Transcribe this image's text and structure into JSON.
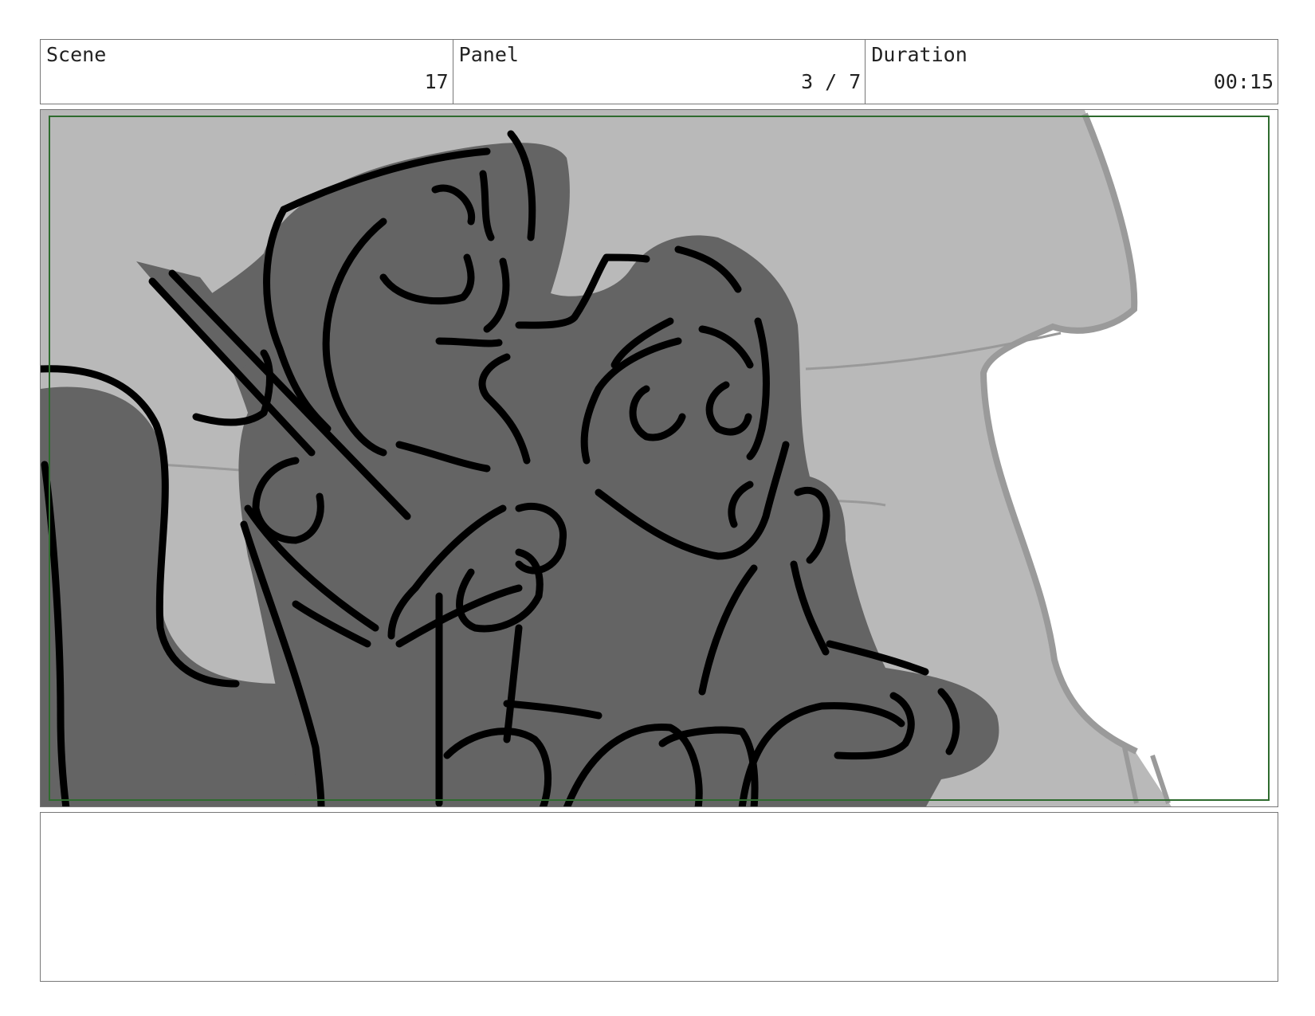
{
  "header": {
    "scene_label": "Scene",
    "scene_value": "17",
    "panel_label": "Panel",
    "panel_value": "3 / 7",
    "duration_label": "Duration",
    "duration_value": "00:15"
  },
  "colors": {
    "border": "#777777",
    "safe_frame": "#2e6b2e",
    "sketch_light_gray": "#b9b9b9",
    "sketch_dark_gray": "#646464",
    "sketch_line": "#000000"
  },
  "notes": {
    "text": ""
  }
}
